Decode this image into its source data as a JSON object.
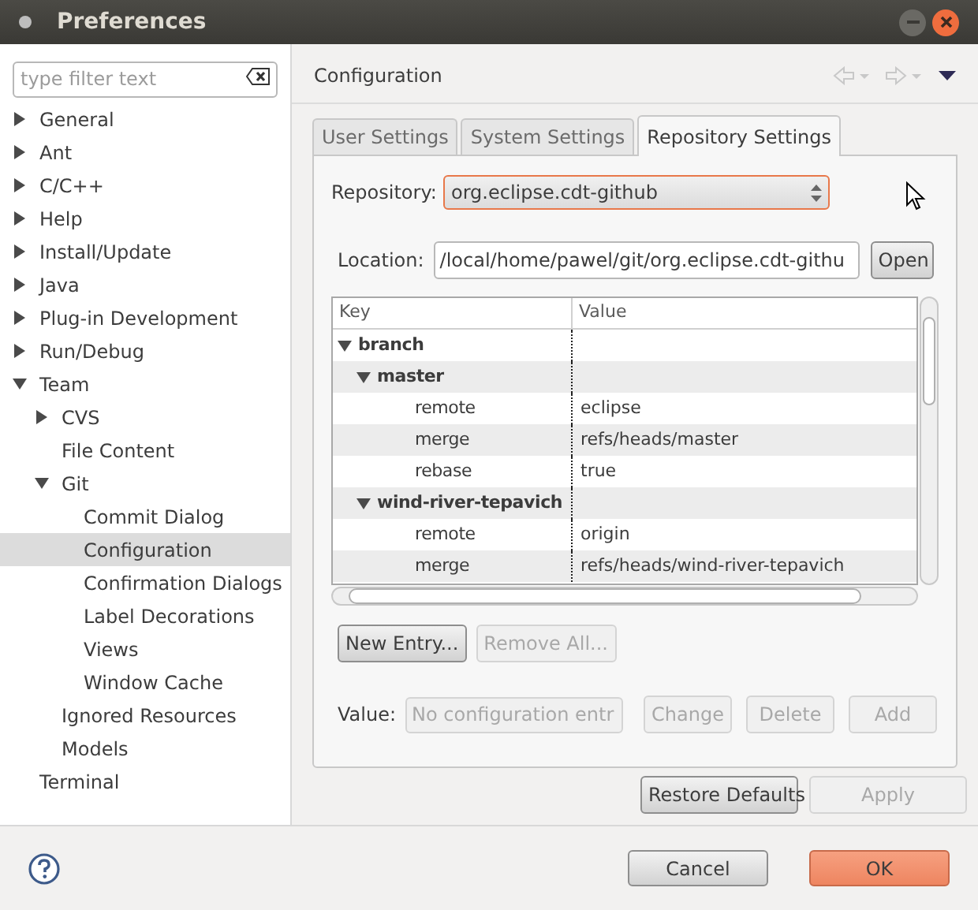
{
  "window": {
    "title": "Preferences"
  },
  "filter": {
    "placeholder": "type filter text"
  },
  "tree": [
    {
      "label": "General",
      "expanded": false,
      "selected": false
    },
    {
      "label": "Ant",
      "expanded": false,
      "selected": false
    },
    {
      "label": "C/C++",
      "expanded": false,
      "selected": false
    },
    {
      "label": "Help",
      "expanded": false,
      "selected": false
    },
    {
      "label": "Install/Update",
      "expanded": false,
      "selected": false
    },
    {
      "label": "Java",
      "expanded": false,
      "selected": false
    },
    {
      "label": "Plug-in Development",
      "expanded": false,
      "selected": false
    },
    {
      "label": "Run/Debug",
      "expanded": false,
      "selected": false
    },
    {
      "label": "Team",
      "expanded": true,
      "selected": false,
      "children": [
        {
          "label": "CVS",
          "expanded": false,
          "selected": false
        },
        {
          "label": "File Content",
          "selected": false
        },
        {
          "label": "Git",
          "expanded": true,
          "selected": false,
          "children": [
            {
              "label": "Commit Dialog",
              "selected": false
            },
            {
              "label": "Configuration",
              "selected": true
            },
            {
              "label": "Confirmation Dialogs",
              "selected": false
            },
            {
              "label": "Label Decorations",
              "selected": false
            },
            {
              "label": "Views",
              "selected": false
            },
            {
              "label": "Window Cache",
              "selected": false
            }
          ]
        },
        {
          "label": "Ignored Resources",
          "selected": false
        },
        {
          "label": "Models",
          "selected": false
        }
      ]
    },
    {
      "label": "Terminal",
      "selected": false
    }
  ],
  "page": {
    "title": "Configuration"
  },
  "tabs": [
    {
      "label": "User Settings",
      "selected": false
    },
    {
      "label": "System Settings",
      "selected": false
    },
    {
      "label": "Repository Settings",
      "selected": true
    }
  ],
  "repository": {
    "label": "Repository:",
    "value": "org.eclipse.cdt-github"
  },
  "location": {
    "label": "Location:",
    "value": "/local/home/pawel/git/org.eclipse.cdt-githu",
    "button": "Open"
  },
  "table": {
    "columns": [
      "Key",
      "Value"
    ],
    "rows": [
      {
        "key": "branch",
        "expanded": true,
        "children": [
          {
            "key": "master",
            "expanded": true,
            "children": [
              {
                "key": "remote",
                "value": "eclipse"
              },
              {
                "key": "merge",
                "value": "refs/heads/master"
              },
              {
                "key": "rebase",
                "value": "true"
              }
            ]
          },
          {
            "key": "wind-river-tepavich",
            "expanded": true,
            "children": [
              {
                "key": "remote",
                "value": "origin"
              },
              {
                "key": "merge",
                "value": "refs/heads/wind-river-tepavich"
              }
            ]
          }
        ]
      }
    ]
  },
  "entry_buttons": [
    {
      "label": "New Entry...",
      "disabled": false
    },
    {
      "label": "Remove All...",
      "disabled": true
    }
  ],
  "value": {
    "label": "Value:",
    "placeholder": "No configuration entr",
    "buttons": [
      {
        "label": "Change",
        "disabled": true
      },
      {
        "label": "Delete",
        "disabled": true
      },
      {
        "label": "Add",
        "disabled": true
      }
    ]
  },
  "page_buttons": [
    {
      "label": "Restore Defaults",
      "disabled": false
    },
    {
      "label": "Apply",
      "disabled": true
    }
  ],
  "dialog_buttons": [
    {
      "label": "Cancel",
      "kind": "normal"
    },
    {
      "label": "OK",
      "kind": "default"
    }
  ]
}
